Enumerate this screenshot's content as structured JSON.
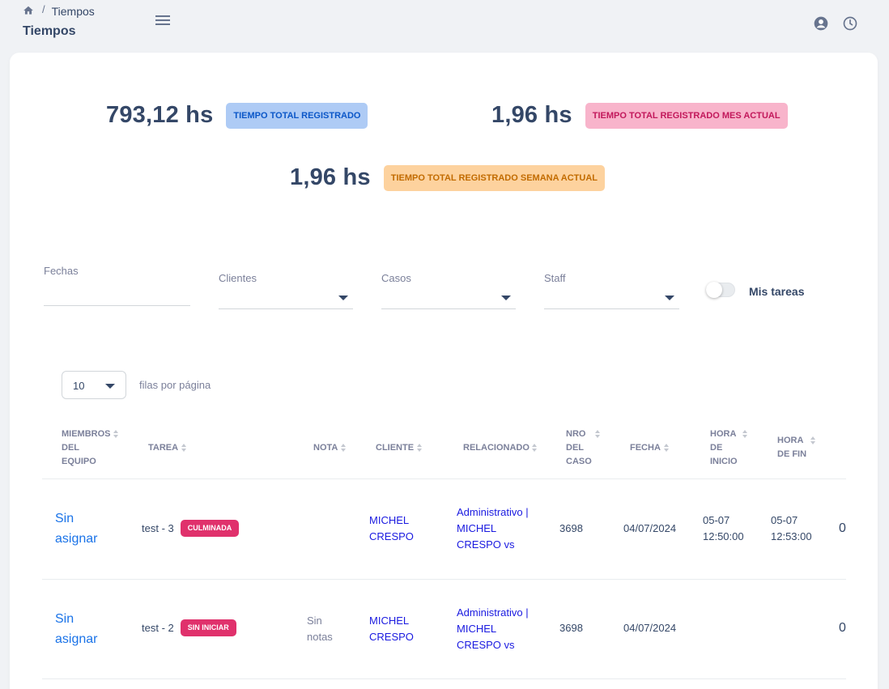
{
  "breadcrumb": {
    "current": "Tiempos"
  },
  "page_title": "Tiempos",
  "stats": [
    {
      "value": "793,12 hs",
      "label": "TIEMPO TOTAL REGISTRADO",
      "color": "#0b57c8",
      "bg": "#aecbf5"
    },
    {
      "value": "1,96 hs",
      "label": "TIEMPO TOTAL REGISTRADO MES ACTUAL",
      "color": "#c2185b",
      "bg": "#f8b4cb"
    },
    {
      "value": "1,96 hs",
      "label": "TIEMPO TOTAL REGISTRADO SEMANA ACTUAL",
      "color": "#c26b00",
      "bg": "#fdd29e"
    }
  ],
  "filters": {
    "fechas": "Fechas",
    "clientes": "Clientes",
    "casos": "Casos",
    "staff": "Staff",
    "mis_tareas": "Mis tareas",
    "mis_tareas_on": false
  },
  "pagination": {
    "rows_value": "10",
    "rows_label": "filas por página"
  },
  "table": {
    "headers": {
      "miembros": [
        "MIEMBROS",
        "DEL",
        "EQUIPO"
      ],
      "tarea": "TAREA",
      "nota": "NOTA",
      "cliente": "CLIENTE",
      "relacionado": "RELACIONADO",
      "nro": [
        "NRO",
        "DEL",
        "CASO"
      ],
      "fecha": "FECHA",
      "hora_inicio": [
        "HORA",
        "DE",
        "INICIO"
      ],
      "hora_fin": [
        "HORA",
        "DE FIN"
      ]
    },
    "rows": [
      {
        "member": [
          "Sin",
          "asignar"
        ],
        "task": "test - 3",
        "status": "CULMINADA",
        "note": [
          "",
          ""
        ],
        "client": [
          "MICHEL",
          "CRESPO"
        ],
        "related": [
          "Administrativo |",
          "MICHEL",
          "CRESPO vs"
        ],
        "case_no": "3698",
        "date": "04/07/2024",
        "start": [
          "05-07",
          "12:50:00"
        ],
        "end": [
          "05-07",
          "12:53:00"
        ],
        "extra": "0"
      },
      {
        "member": [
          "Sin",
          "asignar"
        ],
        "task": "test - 2",
        "status": "SIN INICIAR",
        "note": [
          "Sin",
          "notas"
        ],
        "client": [
          "MICHEL",
          "CRESPO"
        ],
        "related": [
          "Administrativo |",
          "MICHEL",
          "CRESPO vs"
        ],
        "case_no": "3698",
        "date": "04/07/2024",
        "start": [
          "",
          ""
        ],
        "end": [
          "",
          ""
        ],
        "extra": "0"
      }
    ]
  }
}
